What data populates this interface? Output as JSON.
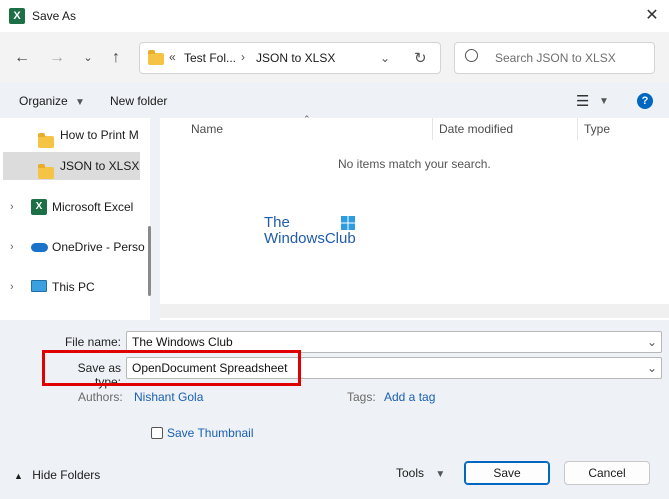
{
  "window": {
    "title": "Save As",
    "app_icon": "excel-icon"
  },
  "nav": {
    "breadcrumb_prefix": "«",
    "crumb_1": "Test Fol...",
    "separator": "›",
    "crumb_2": "JSON to XLSX",
    "search_placeholder": "Search JSON to XLSX"
  },
  "cmdbar": {
    "organize": "Organize",
    "new_folder": "New folder",
    "help": "?"
  },
  "tree": {
    "items": [
      {
        "label": "How to Print M",
        "icon": "folder-icon"
      },
      {
        "label": "JSON to XLSX",
        "icon": "folder-icon",
        "selected": true
      },
      {
        "label": "Microsoft Excel",
        "icon": "excel-icon"
      },
      {
        "label": "OneDrive - Perso",
        "icon": "onedrive-icon"
      },
      {
        "label": "This PC",
        "icon": "pc-icon"
      }
    ]
  },
  "list": {
    "columns": [
      "Name",
      "Date modified",
      "Type"
    ],
    "empty_message": "No items match your search."
  },
  "watermark": {
    "line1": "The",
    "line2": "WindowsClub"
  },
  "form": {
    "file_name_label": "File name:",
    "file_name_value": "The Windows Club",
    "save_type_label": "Save as type:",
    "save_type_value": "OpenDocument Spreadsheet",
    "authors_label": "Authors:",
    "authors_value": "Nishant Gola",
    "tags_label": "Tags:",
    "tags_value": "Add a tag",
    "thumbnail_label": "Save Thumbnail"
  },
  "footer": {
    "hide_folders": "Hide Folders",
    "tools": "Tools",
    "save": "Save",
    "cancel": "Cancel"
  },
  "colors": {
    "highlight": "#e00000",
    "accent": "#0067c0",
    "link": "#1a5fb4"
  }
}
